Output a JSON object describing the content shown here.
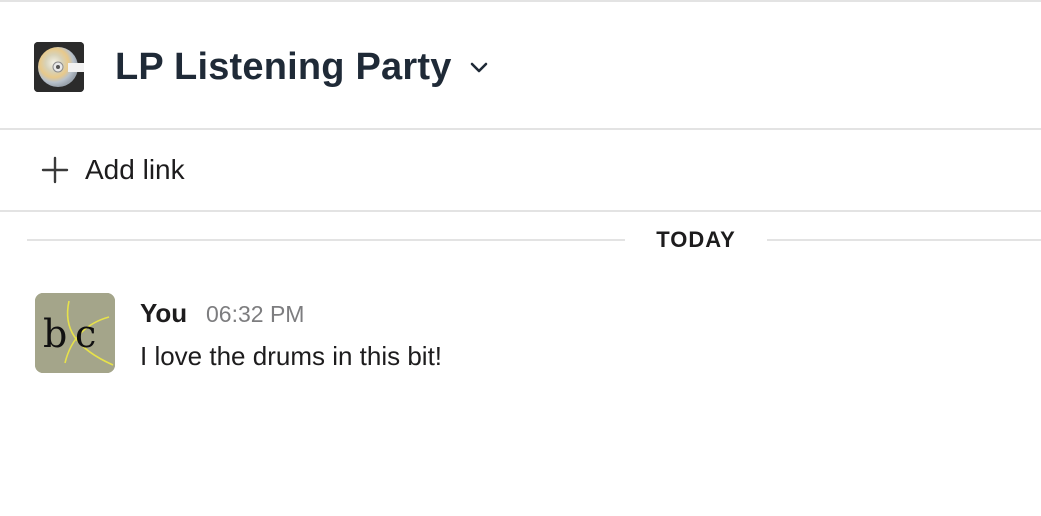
{
  "header": {
    "channel_icon": "optical-disc-icon",
    "title": "LP Listening Party",
    "dropdown_icon": "chevron-down-icon"
  },
  "link_bar": {
    "icon": "plus-icon",
    "add_link_label": "Add link"
  },
  "date_divider": {
    "label": "TODAY"
  },
  "messages": [
    {
      "avatar_icon": "bc-logo-avatar",
      "sender": "You",
      "time": "06:32 PM",
      "text": "I love the drums in this bit!"
    }
  ],
  "colors": {
    "title": "#1f2a37",
    "text": "#1d1c1d",
    "timestamp": "#7d7d7f",
    "divider": "#e3e3e3",
    "avatar_bg": "#a4a58a"
  }
}
